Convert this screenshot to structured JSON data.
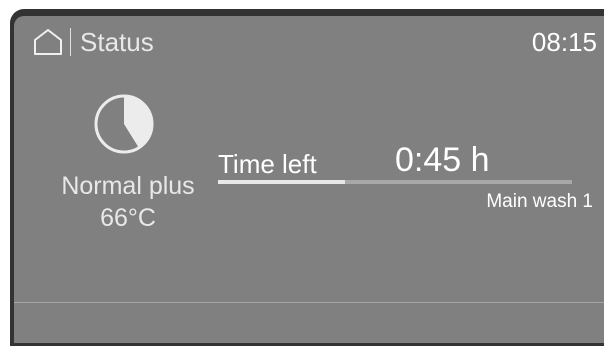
{
  "header": {
    "home_icon": "home-icon",
    "title": "Status",
    "time": "08:15"
  },
  "program": {
    "icon": "pie-progress-icon",
    "name": "Normal plus",
    "temperature": "66°C"
  },
  "status": {
    "time_left_label": "Time left",
    "time_left_value": "0:45 h",
    "progress_fraction": 0.36,
    "phase": "Main wash 1"
  },
  "colors": {
    "screen_background": "#808080",
    "bezel": "#333333",
    "text": "#ffffff"
  }
}
